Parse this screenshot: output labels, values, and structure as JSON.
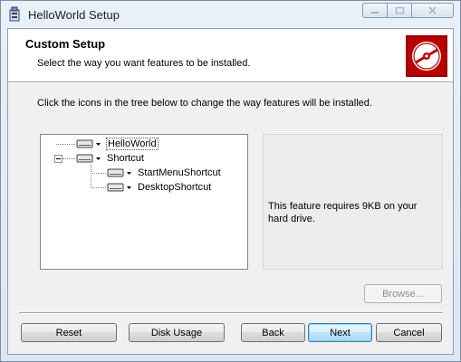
{
  "window": {
    "title": "HelloWorld Setup",
    "icons": {
      "app": "installer-icon",
      "minimize": "minimize-icon",
      "maximize": "maximize-icon",
      "close": "close-icon"
    }
  },
  "banner": {
    "title": "Custom Setup",
    "subtitle": "Select the way you want features to be installed.",
    "logo_icon": "disc-icon",
    "logo_color": "#b80000"
  },
  "instruction": "Click the icons in the tree below to change the way features will be installed.",
  "tree": {
    "items": [
      {
        "label": "HelloWorld",
        "icon": "drive-icon",
        "selected": true
      },
      {
        "label": "Shortcut",
        "icon": "drive-icon",
        "expanded": true
      },
      {
        "label": "StartMenuShortcut",
        "icon": "drive-icon"
      },
      {
        "label": "DesktopShortcut",
        "icon": "drive-icon"
      }
    ]
  },
  "info": {
    "text": "This feature requires 9KB on your hard drive."
  },
  "buttons": {
    "browse": "Browse...",
    "reset": "Reset",
    "disk_usage": "Disk Usage",
    "back": "Back",
    "next": "Next",
    "cancel": "Cancel"
  }
}
